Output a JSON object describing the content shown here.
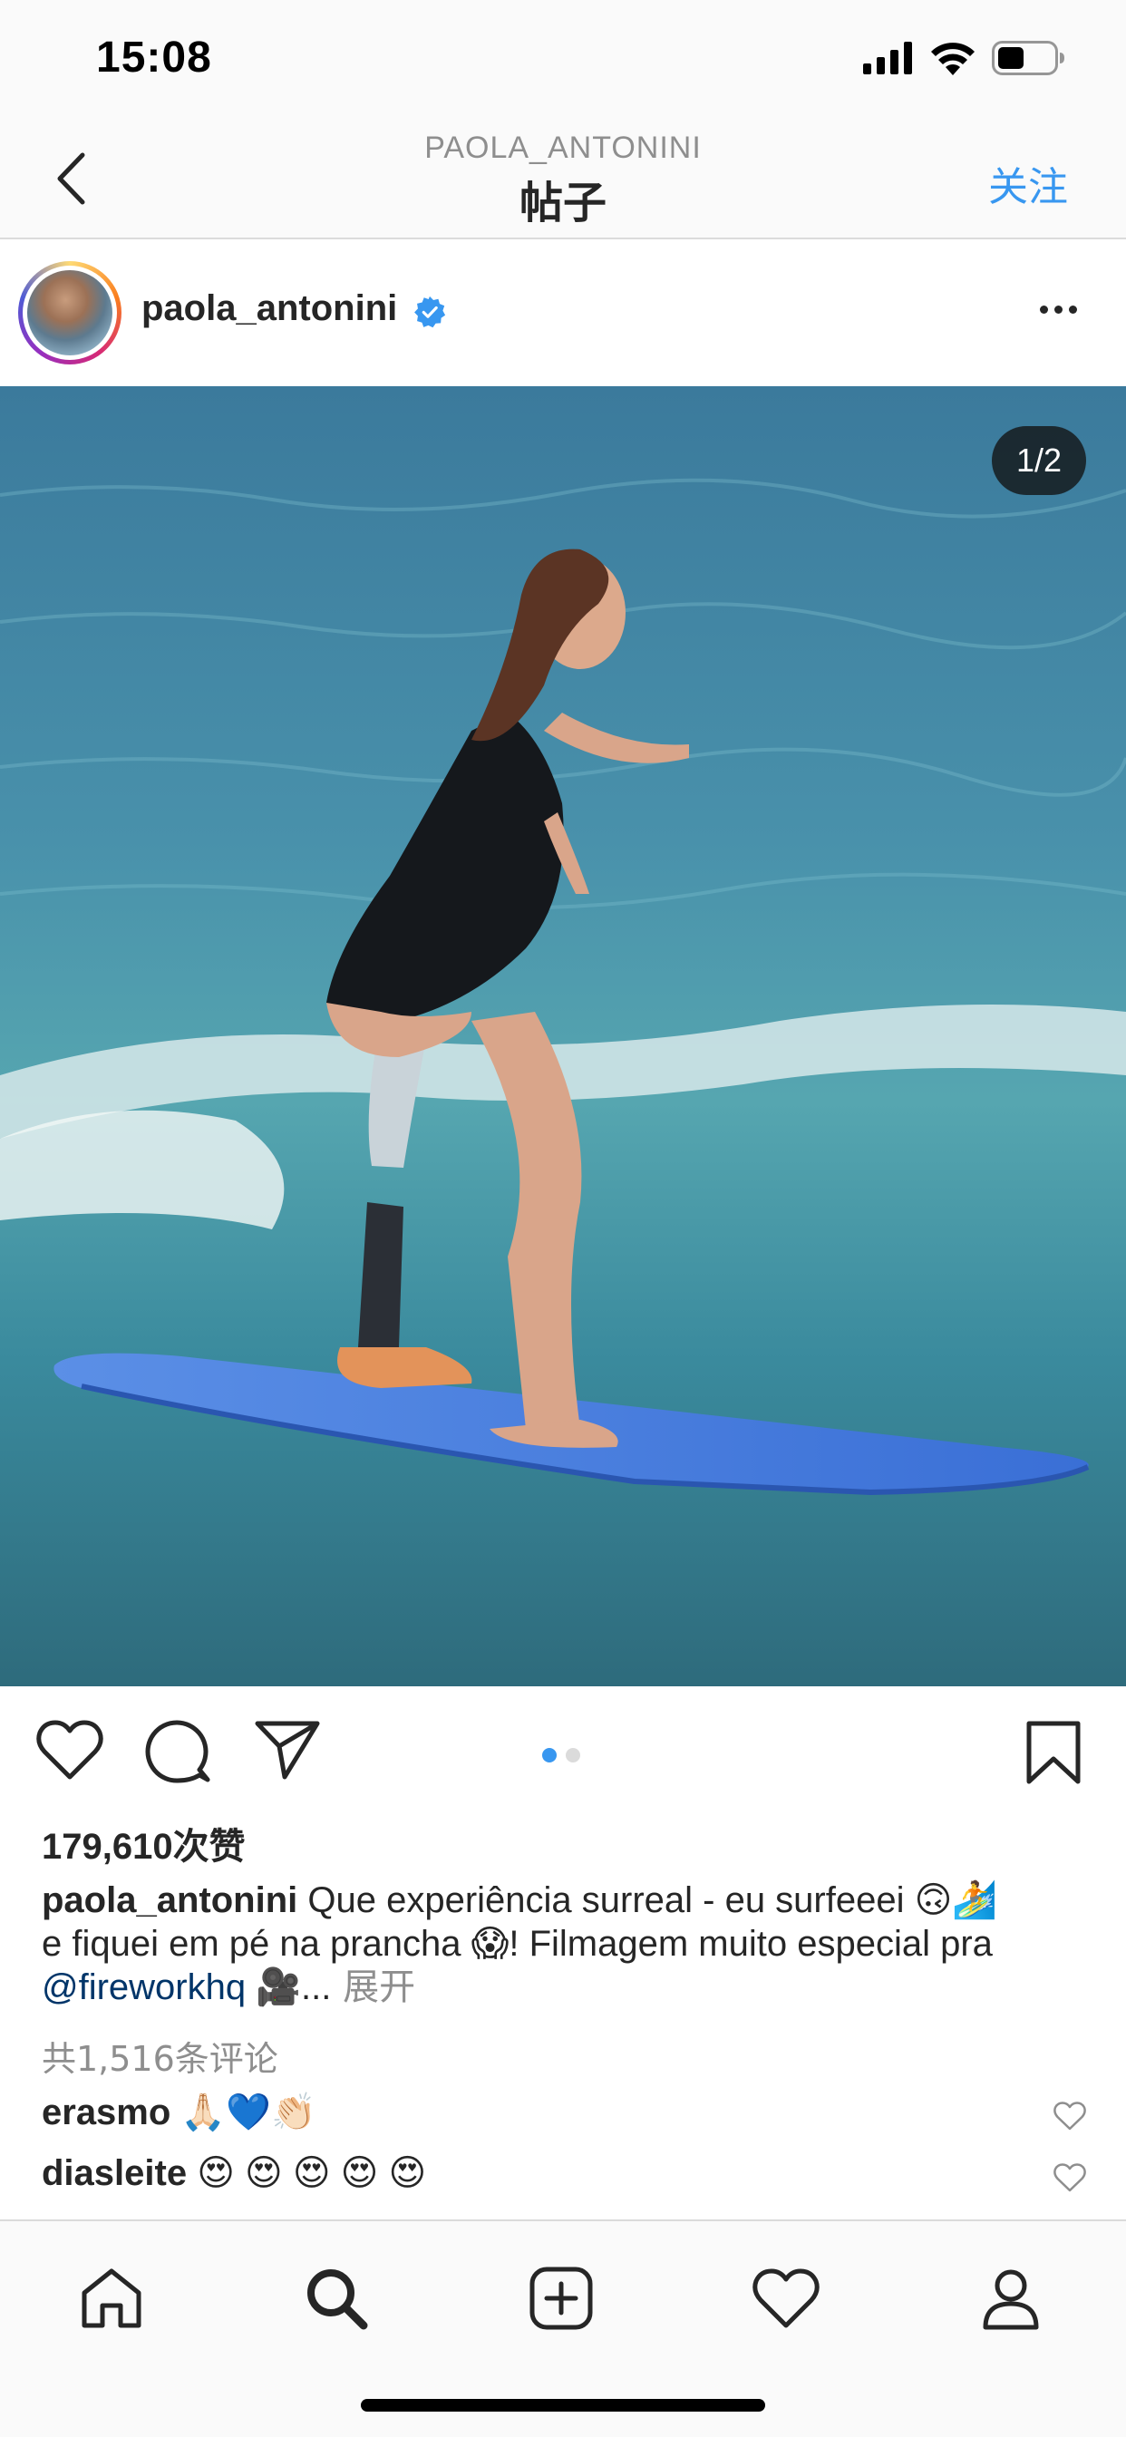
{
  "status_bar": {
    "time": "15:08",
    "icons": [
      "signal-icon",
      "wifi-icon",
      "battery-icon"
    ]
  },
  "header": {
    "subtitle": "PAOLA_ANTONINI",
    "title": "帖子",
    "follow_label": "关注",
    "icons": [
      "back-chevron-icon"
    ]
  },
  "post": {
    "username": "paola_antonini",
    "verified_icon": "verified-badge-icon",
    "more_icon": "more-dots-icon",
    "image_counter": "1/2",
    "carousel": {
      "current": 1,
      "total": 2
    },
    "likes_count": "179,610",
    "likes_unit": "次赞",
    "caption": {
      "username": "paola_antonini",
      "line1": " Que experiência surreal - eu surfeeei 🙃🏄",
      "line2": "e fiquei em pé na prancha 😱! Filmagem muito especial pra",
      "mention": "@fireworkhq",
      "tail": " 🎥...",
      "more": " 展开"
    },
    "comments_link": "共1,516条评论",
    "comments": [
      {
        "username": "erasmo",
        "text": " 🙏🏻💙👏🏻"
      },
      {
        "username": "diasleite",
        "text": " 😍 😍 😍 😍 😍"
      }
    ]
  },
  "actions": {
    "icons": [
      "heart-icon",
      "comment-icon",
      "share-icon",
      "bookmark-icon"
    ]
  },
  "tab_bar": {
    "icons": [
      "home-icon",
      "search-icon",
      "add-post-icon",
      "activity-heart-icon",
      "profile-icon"
    ]
  },
  "colors": {
    "accent": "#3897f0",
    "text": "#262626",
    "muted": "#8e8e8e",
    "mention": "#003569",
    "dot_active": "#3897f0",
    "dot_inactive": "#dbdbdb"
  }
}
